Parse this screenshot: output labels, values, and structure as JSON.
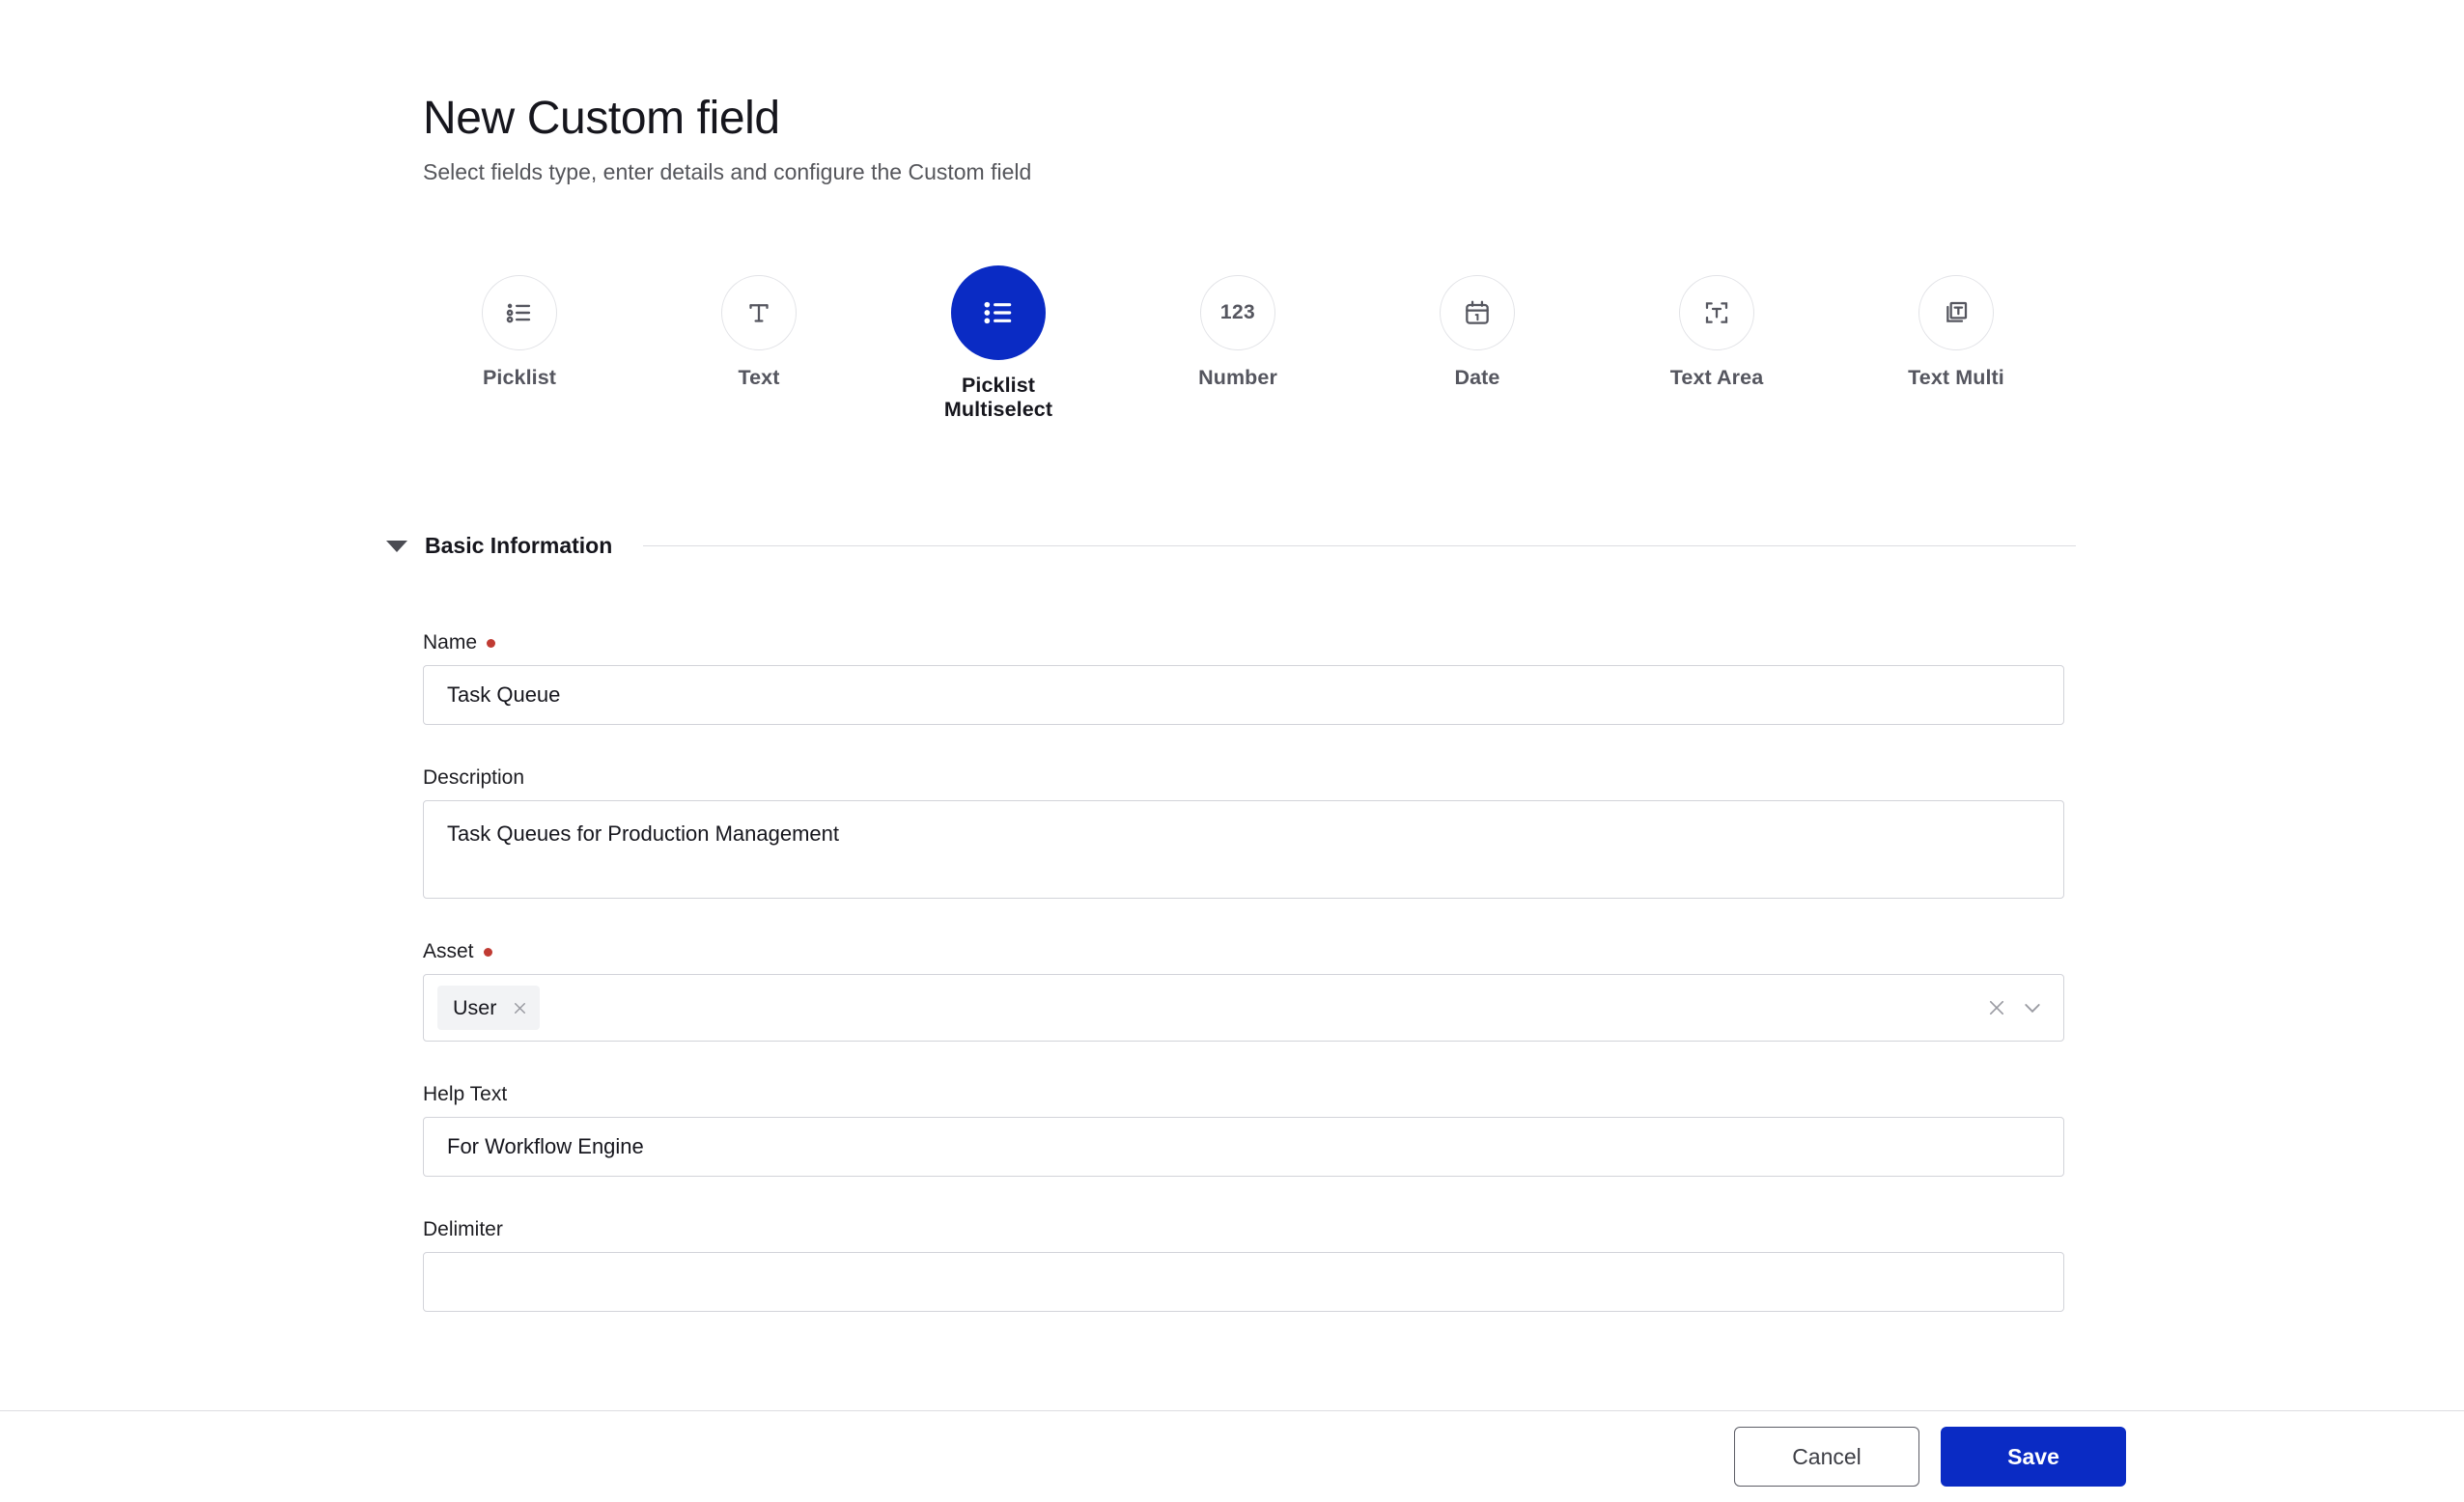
{
  "header": {
    "title": "New Custom field",
    "subtitle": "Select fields type, enter details and configure the Custom field"
  },
  "field_types": [
    {
      "label": "Picklist",
      "icon": "bulleted-list-icon",
      "selected": false
    },
    {
      "label": "Text",
      "icon": "text-t-icon",
      "selected": false
    },
    {
      "label": "Picklist\nMultiselect",
      "icon": "bulleted-list-icon",
      "selected": true
    },
    {
      "label": "Number",
      "icon": "number-123-icon",
      "selected": false
    },
    {
      "label": "Date",
      "icon": "calendar-icon",
      "selected": false
    },
    {
      "label": "Text Area",
      "icon": "text-area-icon",
      "selected": false
    },
    {
      "label": "Text Multi",
      "icon": "text-multi-icon",
      "selected": false
    }
  ],
  "section": {
    "title": "Basic Information",
    "expanded": true
  },
  "form": {
    "name": {
      "label": "Name",
      "required": true,
      "value": "Task Queue",
      "placeholder": ""
    },
    "description": {
      "label": "Description",
      "required": false,
      "value": "Task Queues for Production Management",
      "placeholder": ""
    },
    "asset": {
      "label": "Asset",
      "required": true,
      "chips": [
        "User"
      ],
      "placeholder": ""
    },
    "help_text": {
      "label": "Help Text",
      "required": false,
      "value": "For Workflow Engine",
      "placeholder": ""
    },
    "delimiter": {
      "label": "Delimiter",
      "required": false,
      "value": "",
      "placeholder": ""
    }
  },
  "footer": {
    "cancel_label": "Cancel",
    "save_label": "Save"
  },
  "colors": {
    "accent": "#0a2bc4",
    "required": "#c03b33",
    "border": "#d2d3d9",
    "muted_text": "#55565f",
    "chip_bg": "#f2f3f5"
  }
}
